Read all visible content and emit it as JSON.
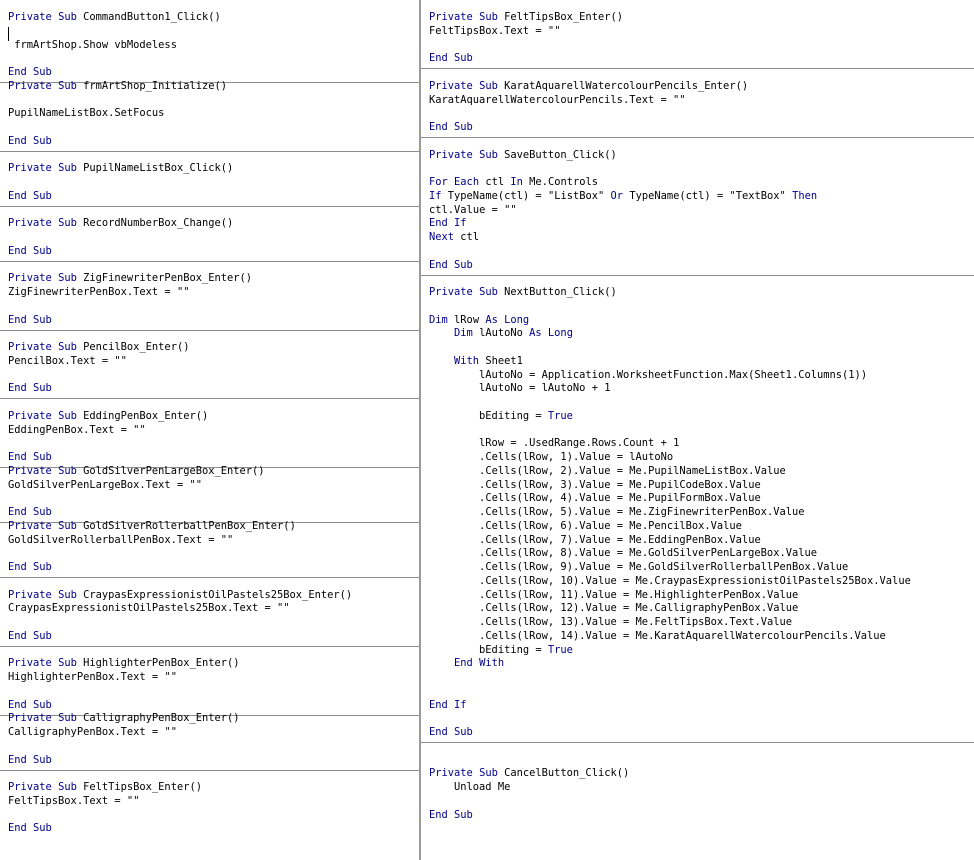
{
  "left_blocks": [
    {
      "lines": [
        "Private Sub CommandButton1_Click()",
        "",
        " frmArtShop.Show vbModeless",
        "",
        "End Sub"
      ]
    },
    {
      "lines": [
        "Private Sub frmArtShop_Initialize()",
        "",
        "PupilNameListBox.SetFocus",
        "",
        "End Sub"
      ]
    },
    {
      "lines": [
        "",
        "Private Sub PupilNameListBox_Click()",
        "",
        "End Sub"
      ]
    },
    {
      "lines": [
        "",
        "Private Sub RecordNumberBox_Change()",
        "",
        "End Sub"
      ]
    },
    {
      "lines": [
        "",
        "Private Sub ZigFinewriterPenBox_Enter()",
        "ZigFinewriterPenBox.Text = \"\"",
        "",
        "End Sub"
      ]
    },
    {
      "lines": [
        "",
        "Private Sub PencilBox_Enter()",
        "PencilBox.Text = \"\"",
        "",
        "End Sub"
      ]
    },
    {
      "lines": [
        "",
        "Private Sub EddingPenBox_Enter()",
        "EddingPenBox.Text = \"\"",
        "",
        "End Sub"
      ]
    },
    {
      "lines": [
        "Private Sub GoldSilverPenLargeBox_Enter()",
        "GoldSilverPenLargeBox.Text = \"\"",
        "",
        "End Sub"
      ]
    },
    {
      "lines": [
        "Private Sub GoldSilverRollerballPenBox_Enter()",
        "GoldSilverRollerballPenBox.Text = \"\"",
        "",
        "End Sub"
      ]
    },
    {
      "lines": [
        "",
        "Private Sub CraypasExpressionistOilPastels25Box_Enter()",
        "CraypasExpressionistOilPastels25Box.Text = \"\"",
        "",
        "End Sub"
      ]
    },
    {
      "lines": [
        "",
        "Private Sub HighlighterPenBox_Enter()",
        "HighlighterPenBox.Text = \"\"",
        "",
        "End Sub"
      ]
    },
    {
      "lines": [
        "Private Sub CalligraphyPenBox_Enter()",
        "CalligraphyPenBox.Text = \"\"",
        "",
        "End Sub"
      ]
    },
    {
      "lines": [
        "",
        "Private Sub FeltTipsBox_Enter()",
        "FeltTipsBox.Text = \"\"",
        "",
        "End Sub"
      ]
    }
  ],
  "right_blocks": [
    {
      "lines": [
        "Private Sub FeltTipsBox_Enter()",
        "FeltTipsBox.Text = \"\"",
        "",
        "End Sub"
      ]
    },
    {
      "lines": [
        "",
        "Private Sub KaratAquarellWatercolourPencils_Enter()",
        "KaratAquarellWatercolourPencils.Text = \"\"",
        "",
        "End Sub"
      ]
    },
    {
      "lines": [
        "",
        "Private Sub SaveButton_Click()",
        "",
        "For Each ctl In Me.Controls",
        "If TypeName(ctl) = \"ListBox\" Or TypeName(ctl) = \"TextBox\" Then",
        "ctl.Value = \"\"",
        "End If",
        "Next ctl",
        "",
        "End Sub"
      ]
    },
    {
      "lines": [
        "",
        "Private Sub NextButton_Click()",
        "",
        "Dim lRow As Long",
        "    Dim lAutoNo As Long",
        "",
        "    With Sheet1",
        "        lAutoNo = Application.WorksheetFunction.Max(Sheet1.Columns(1))",
        "        lAutoNo = lAutoNo + 1",
        "",
        "        bEditing = True",
        "",
        "        lRow = .UsedRange.Rows.Count + 1",
        "        .Cells(lRow, 1).Value = lAutoNo",
        "        .Cells(lRow, 2).Value = Me.PupilNameListBox.Value",
        "        .Cells(lRow, 3).Value = Me.PupilCodeBox.Value",
        "        .Cells(lRow, 4).Value = Me.PupilFormBox.Value",
        "        .Cells(lRow, 5).Value = Me.ZigFinewriterPenBox.Value",
        "        .Cells(lRow, 6).Value = Me.PencilBox.Value",
        "        .Cells(lRow, 7).Value = Me.EddingPenBox.Value",
        "        .Cells(lRow, 8).Value = Me.GoldSilverPenLargeBox.Value",
        "        .Cells(lRow, 9).Value = Me.GoldSilverRollerballPenBox.Value",
        "        .Cells(lRow, 10).Value = Me.CraypasExpressionistOilPastels25Box.Value",
        "        .Cells(lRow, 11).Value = Me.HighlighterPenBox.Value",
        "        .Cells(lRow, 12).Value = Me.CalligraphyPenBox.Value",
        "        .Cells(lRow, 13).Value = Me.FeltTipsBox.Text.Value",
        "        .Cells(lRow, 14).Value = Me.KaratAquarellWatercolourPencils.Value",
        "        bEditing = True",
        "    End With",
        "",
        "",
        "End If",
        "",
        "End Sub"
      ]
    },
    {
      "lines": [
        "",
        "",
        "Private Sub CancelButton_Click()",
        "    Unload Me",
        "",
        "End Sub"
      ]
    }
  ],
  "keywords": [
    "Private",
    "Sub",
    "End",
    "With",
    "Dim",
    "As",
    "Long",
    "For",
    "Each",
    "In",
    "If",
    "Or",
    "Then",
    "Next",
    "True"
  ],
  "colors": {
    "keyword": "#00008b",
    "text": "#000000",
    "separator": "#8c8c8c",
    "background": "#ffffff"
  }
}
